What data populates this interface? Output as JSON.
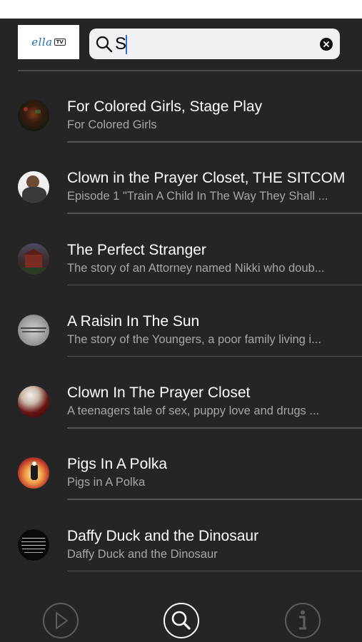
{
  "header": {
    "logo_text": "ella",
    "logo_badge": "TV"
  },
  "search": {
    "value": "S",
    "placeholder": ""
  },
  "results": [
    {
      "title": "For Colored Girls, Stage Play",
      "subtitle": "For Colored Girls"
    },
    {
      "title": "Clown in the Prayer Closet, THE SITCOM",
      "subtitle": "Episode 1 \"Train A Child In The Way They Shall ..."
    },
    {
      "title": "The Perfect Stranger",
      "subtitle": "The story of an Attorney named Nikki who doub..."
    },
    {
      "title": "A Raisin In The Sun",
      "subtitle": "The story of the Youngers, a poor family living i..."
    },
    {
      "title": "Clown In The Prayer Closet",
      "subtitle": "A teenagers tale of sex, puppy love and drugs ..."
    },
    {
      "title": "Pigs In A Polka",
      "subtitle": "Pigs in A Polka"
    },
    {
      "title": "Daffy Duck and the Dinosaur",
      "subtitle": "Daffy Duck and the Dinosaur"
    }
  ],
  "tabs": [
    {
      "icon": "play-icon",
      "active": false
    },
    {
      "icon": "search-icon",
      "active": true
    },
    {
      "icon": "info-icon",
      "active": false
    }
  ],
  "colors": {
    "background": "#252525",
    "search_field": "#f1f1f3",
    "subtitle_text": "#a7a7a7",
    "inactive_tab": "#5e5e5e",
    "active_tab": "#ffffff",
    "caret": "#2f6fe4"
  }
}
